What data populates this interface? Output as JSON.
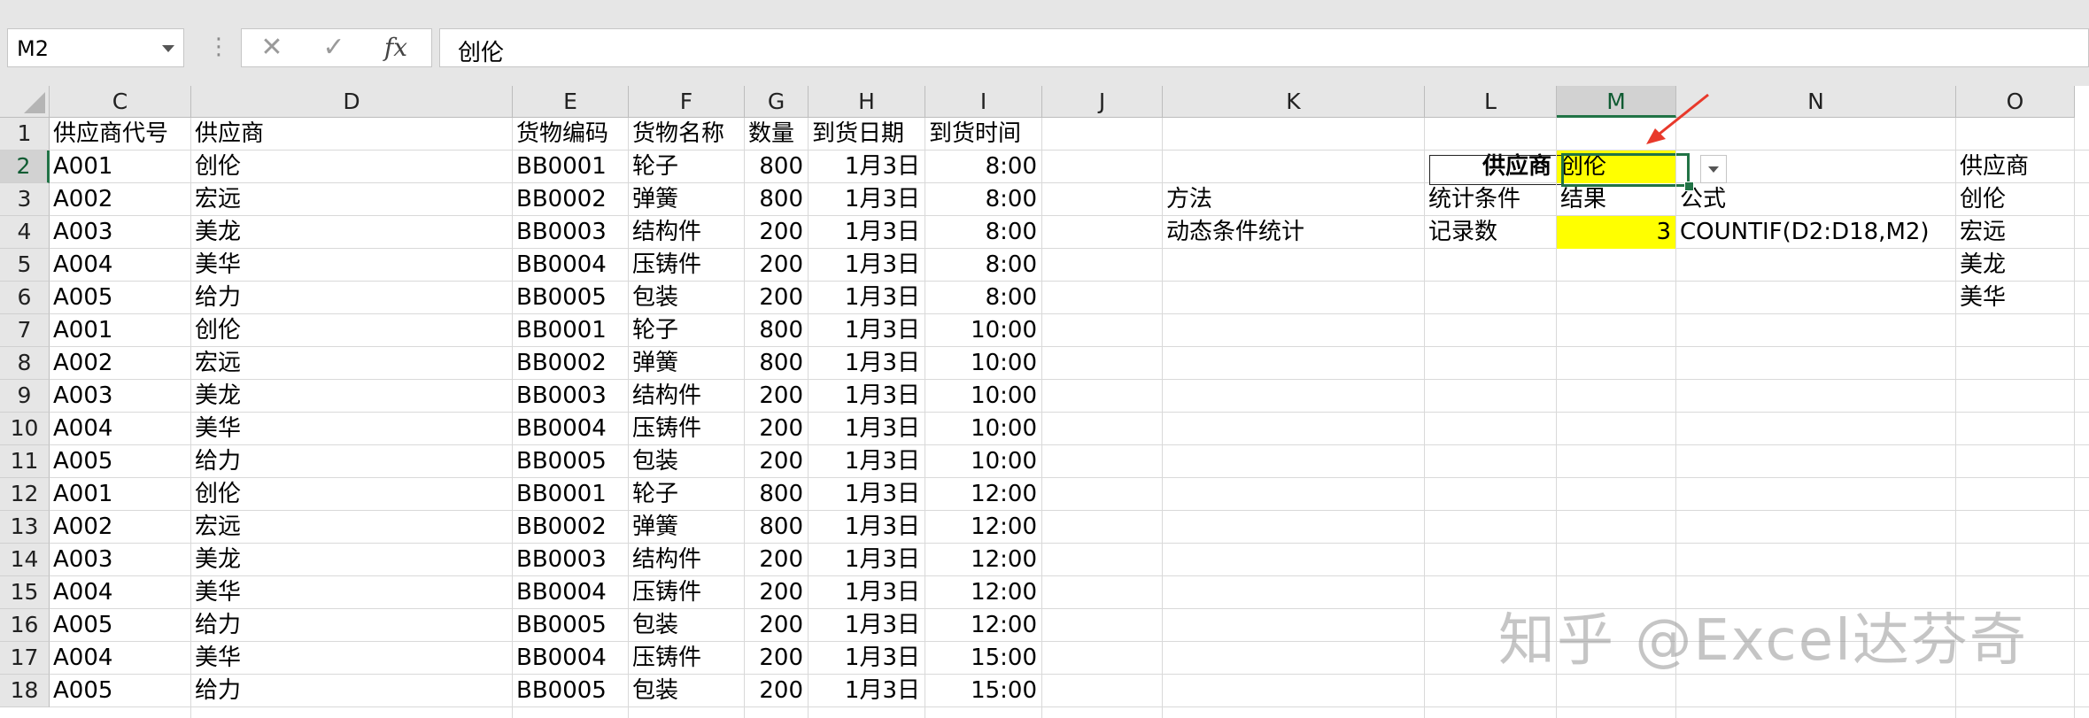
{
  "formula_bar": {
    "name_box": "M2",
    "dots": "⋮",
    "cancel_symbol": "✕",
    "enter_symbol": "✓",
    "fx_symbol": "fx",
    "content": "创伦"
  },
  "columns": [
    "C",
    "D",
    "E",
    "F",
    "G",
    "H",
    "I",
    "J",
    "K",
    "L",
    "M",
    "N",
    "O"
  ],
  "selected_column": "M",
  "selected_row": "2",
  "rows": [
    "1",
    "2",
    "3",
    "4",
    "5",
    "6",
    "7",
    "8",
    "9",
    "10",
    "11",
    "12",
    "13",
    "14",
    "15",
    "16",
    "17",
    "18"
  ],
  "table": {
    "headers": [
      "供应商代号",
      "供应商",
      "货物编码",
      "货物名称",
      "数量",
      "到货日期",
      "到货时间"
    ],
    "records": [
      [
        "A001",
        "创伦",
        "BB0001",
        "轮子",
        "800",
        "1月3日",
        "8:00"
      ],
      [
        "A002",
        "宏远",
        "BB0002",
        "弹簧",
        "800",
        "1月3日",
        "8:00"
      ],
      [
        "A003",
        "美龙",
        "BB0003",
        "结构件",
        "200",
        "1月3日",
        "8:00"
      ],
      [
        "A004",
        "美华",
        "BB0004",
        "压铸件",
        "200",
        "1月3日",
        "8:00"
      ],
      [
        "A005",
        "给力",
        "BB0005",
        "包装",
        "200",
        "1月3日",
        "8:00"
      ],
      [
        "A001",
        "创伦",
        "BB0001",
        "轮子",
        "800",
        "1月3日",
        "10:00"
      ],
      [
        "A002",
        "宏远",
        "BB0002",
        "弹簧",
        "800",
        "1月3日",
        "10:00"
      ],
      [
        "A003",
        "美龙",
        "BB0003",
        "结构件",
        "200",
        "1月3日",
        "10:00"
      ],
      [
        "A004",
        "美华",
        "BB0004",
        "压铸件",
        "200",
        "1月3日",
        "10:00"
      ],
      [
        "A005",
        "给力",
        "BB0005",
        "包装",
        "200",
        "1月3日",
        "10:00"
      ],
      [
        "A001",
        "创伦",
        "BB0001",
        "轮子",
        "800",
        "1月3日",
        "12:00"
      ],
      [
        "A002",
        "宏远",
        "BB0002",
        "弹簧",
        "800",
        "1月3日",
        "12:00"
      ],
      [
        "A003",
        "美龙",
        "BB0003",
        "结构件",
        "200",
        "1月3日",
        "12:00"
      ],
      [
        "A004",
        "美华",
        "BB0004",
        "压铸件",
        "200",
        "1月3日",
        "12:00"
      ],
      [
        "A005",
        "给力",
        "BB0005",
        "包装",
        "200",
        "1月3日",
        "12:00"
      ],
      [
        "A004",
        "美华",
        "BB0004",
        "压铸件",
        "200",
        "1月3日",
        "15:00"
      ],
      [
        "A005",
        "给力",
        "BB0005",
        "包装",
        "200",
        "1月3日",
        "15:00"
      ]
    ]
  },
  "criteria": {
    "supplier_label": "供应商",
    "supplier_value": "创伦",
    "method_header": "方法",
    "condition_header": "统计条件",
    "result_header": "结果",
    "formula_header": "公式",
    "method": "动态条件统计",
    "condition": "记录数",
    "result": "3",
    "formula": "COUNTIF(D2:D18,M2)"
  },
  "supplier_list": [
    "供应商",
    "创伦",
    "宏远",
    "美龙",
    "美华"
  ],
  "colors": {
    "highlight": "#ffff00",
    "selection": "#217346",
    "arrow": "#e8392b"
  },
  "watermark": "知乎 @Excel达芬奇"
}
